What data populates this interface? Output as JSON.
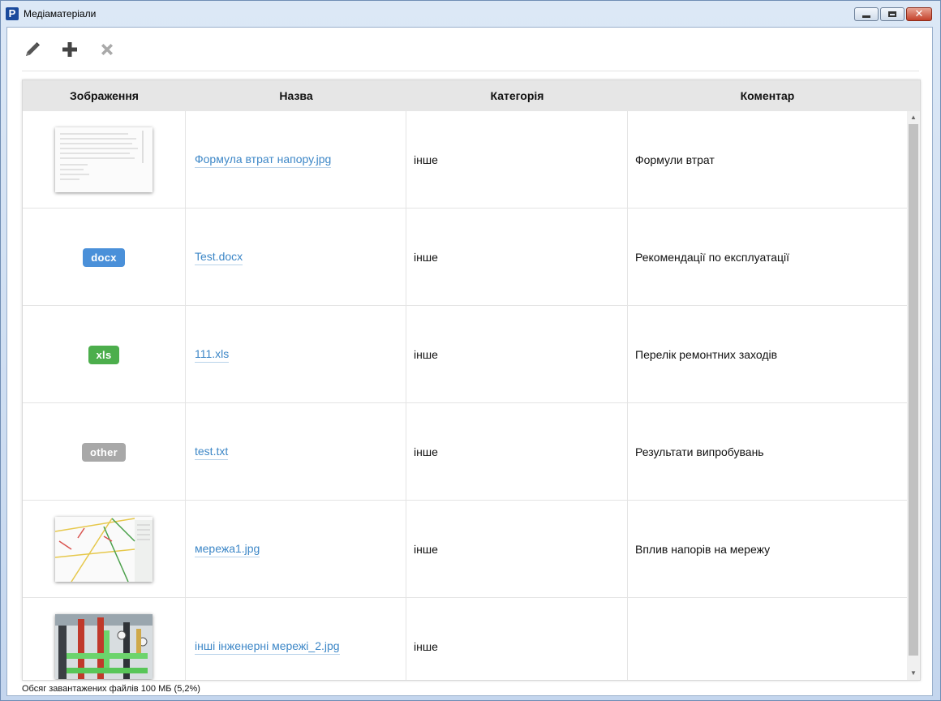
{
  "window": {
    "title": "Медіаматеріали",
    "app_icon_letter": "P"
  },
  "toolbar": {
    "edit_icon": "pencil-icon",
    "add_icon": "plus-icon",
    "delete_icon": "x-icon"
  },
  "table": {
    "columns": [
      "Зображення",
      "Назва",
      "Категорія",
      "Коментар"
    ],
    "rows": [
      {
        "preview": "image",
        "name": "Формула втрат напору.jpg",
        "category": "інше",
        "comment": "Формули втрат"
      },
      {
        "preview": "badge",
        "badge": "docx",
        "badge_color": "#4a90d9",
        "name": "Test.docx",
        "category": "інше",
        "comment": "Рекомендації по експлуатації"
      },
      {
        "preview": "badge",
        "badge": "xls",
        "badge_color": "#4cae4c",
        "name": "111.xls",
        "category": "інше",
        "comment": "Перелік ремонтних заходів"
      },
      {
        "preview": "badge",
        "badge": "other",
        "badge_color": "#a8a8a8",
        "name": "test.txt",
        "category": "інше",
        "comment": "Результати випробувань"
      },
      {
        "preview": "image",
        "name": "мережа1.jpg",
        "category": "інше",
        "comment": "Вплив напорів на мережу"
      },
      {
        "preview": "image",
        "name": "інші інженерні мережі_2.jpg",
        "category": "інше",
        "comment": ""
      }
    ]
  },
  "status": {
    "text": "Обсяг завантажених файлів 100 МБ (5,2%)"
  },
  "colors": {
    "link": "#3d87c7",
    "header_bg": "#e6e6e6"
  }
}
